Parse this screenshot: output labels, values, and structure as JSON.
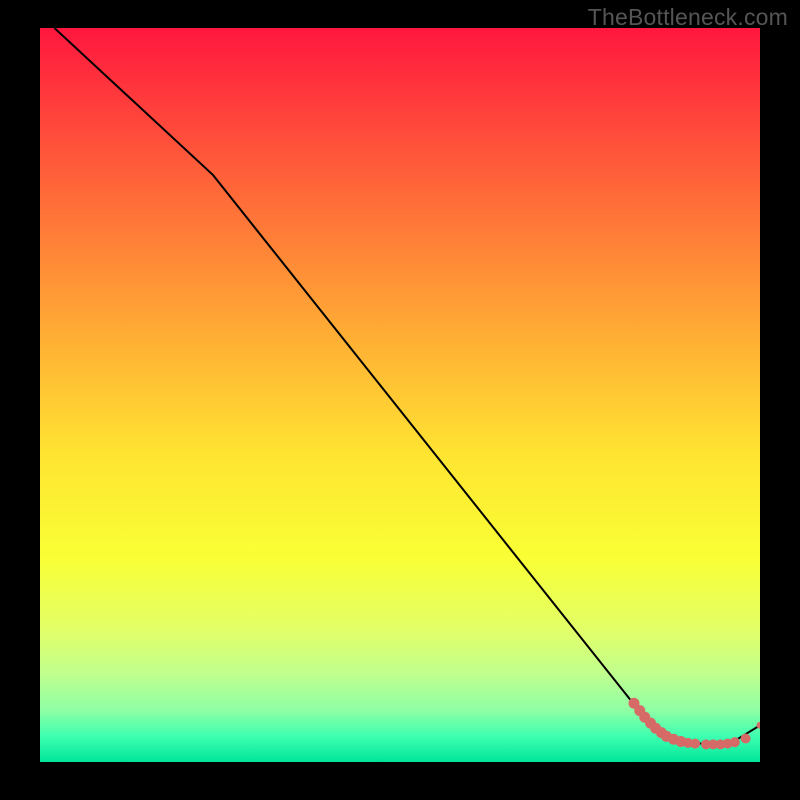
{
  "watermark": "TheBottleneck.com",
  "chart_data": {
    "type": "line",
    "title": "",
    "xlabel": "",
    "ylabel": "",
    "xlim": [
      0,
      100
    ],
    "ylim": [
      0,
      100
    ],
    "grid": false,
    "series": [
      {
        "name": "curve",
        "style": "black-line",
        "points": [
          {
            "x": 2,
            "y": 100
          },
          {
            "x": 24,
            "y": 80
          },
          {
            "x": 84,
            "y": 6
          },
          {
            "x": 86,
            "y": 4
          },
          {
            "x": 90,
            "y": 2.6
          },
          {
            "x": 94,
            "y": 2.4
          },
          {
            "x": 96,
            "y": 2.6
          },
          {
            "x": 100,
            "y": 5
          }
        ]
      },
      {
        "name": "highlight-dots",
        "style": "salmon-dots",
        "points": [
          {
            "x": 82.5,
            "y": 8.0
          },
          {
            "x": 83.3,
            "y": 7.0
          },
          {
            "x": 84.0,
            "y": 6.1
          },
          {
            "x": 84.8,
            "y": 5.3
          },
          {
            "x": 85.5,
            "y": 4.6
          },
          {
            "x": 86.3,
            "y": 4.0
          },
          {
            "x": 87.0,
            "y": 3.5
          },
          {
            "x": 88.0,
            "y": 3.1
          },
          {
            "x": 89.0,
            "y": 2.8
          },
          {
            "x": 90.0,
            "y": 2.6
          },
          {
            "x": 91.0,
            "y": 2.5
          },
          {
            "x": 92.5,
            "y": 2.4
          },
          {
            "x": 93.5,
            "y": 2.4
          },
          {
            "x": 94.5,
            "y": 2.4
          },
          {
            "x": 95.5,
            "y": 2.5
          },
          {
            "x": 96.5,
            "y": 2.7
          },
          {
            "x": 98.0,
            "y": 3.2
          },
          {
            "x": 100.0,
            "y": 5.0
          }
        ]
      }
    ],
    "background_gradient": {
      "stops": [
        {
          "offset": 0.0,
          "color": "#ff173e"
        },
        {
          "offset": 0.18,
          "color": "#ff593a"
        },
        {
          "offset": 0.4,
          "color": "#ffa735"
        },
        {
          "offset": 0.58,
          "color": "#ffe432"
        },
        {
          "offset": 0.72,
          "color": "#f9ff34"
        },
        {
          "offset": 0.82,
          "color": "#e2ff68"
        },
        {
          "offset": 0.88,
          "color": "#c0ff8e"
        },
        {
          "offset": 0.93,
          "color": "#8effa5"
        },
        {
          "offset": 0.965,
          "color": "#3effb0"
        },
        {
          "offset": 1.0,
          "color": "#00e59a"
        }
      ]
    },
    "dot_color": "#d66a66",
    "line_color": "#000000"
  }
}
